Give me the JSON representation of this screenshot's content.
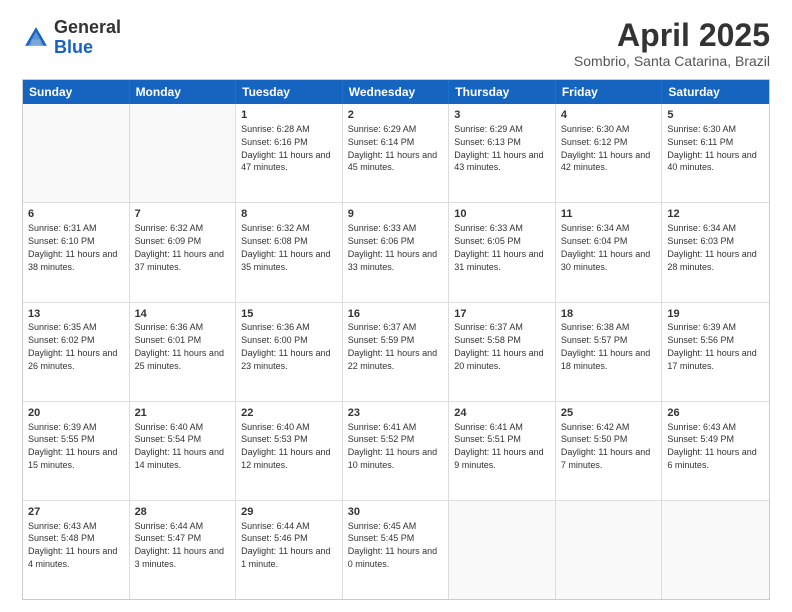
{
  "header": {
    "logo_general": "General",
    "logo_blue": "Blue",
    "month_title": "April 2025",
    "subtitle": "Sombrio, Santa Catarina, Brazil"
  },
  "days_of_week": [
    "Sunday",
    "Monday",
    "Tuesday",
    "Wednesday",
    "Thursday",
    "Friday",
    "Saturday"
  ],
  "weeks": [
    [
      {
        "day": "",
        "empty": true
      },
      {
        "day": "",
        "empty": true
      },
      {
        "day": "1",
        "sunrise": "Sunrise: 6:28 AM",
        "sunset": "Sunset: 6:16 PM",
        "daylight": "Daylight: 11 hours and 47 minutes."
      },
      {
        "day": "2",
        "sunrise": "Sunrise: 6:29 AM",
        "sunset": "Sunset: 6:14 PM",
        "daylight": "Daylight: 11 hours and 45 minutes."
      },
      {
        "day": "3",
        "sunrise": "Sunrise: 6:29 AM",
        "sunset": "Sunset: 6:13 PM",
        "daylight": "Daylight: 11 hours and 43 minutes."
      },
      {
        "day": "4",
        "sunrise": "Sunrise: 6:30 AM",
        "sunset": "Sunset: 6:12 PM",
        "daylight": "Daylight: 11 hours and 42 minutes."
      },
      {
        "day": "5",
        "sunrise": "Sunrise: 6:30 AM",
        "sunset": "Sunset: 6:11 PM",
        "daylight": "Daylight: 11 hours and 40 minutes."
      }
    ],
    [
      {
        "day": "6",
        "sunrise": "Sunrise: 6:31 AM",
        "sunset": "Sunset: 6:10 PM",
        "daylight": "Daylight: 11 hours and 38 minutes."
      },
      {
        "day": "7",
        "sunrise": "Sunrise: 6:32 AM",
        "sunset": "Sunset: 6:09 PM",
        "daylight": "Daylight: 11 hours and 37 minutes."
      },
      {
        "day": "8",
        "sunrise": "Sunrise: 6:32 AM",
        "sunset": "Sunset: 6:08 PM",
        "daylight": "Daylight: 11 hours and 35 minutes."
      },
      {
        "day": "9",
        "sunrise": "Sunrise: 6:33 AM",
        "sunset": "Sunset: 6:06 PM",
        "daylight": "Daylight: 11 hours and 33 minutes."
      },
      {
        "day": "10",
        "sunrise": "Sunrise: 6:33 AM",
        "sunset": "Sunset: 6:05 PM",
        "daylight": "Daylight: 11 hours and 31 minutes."
      },
      {
        "day": "11",
        "sunrise": "Sunrise: 6:34 AM",
        "sunset": "Sunset: 6:04 PM",
        "daylight": "Daylight: 11 hours and 30 minutes."
      },
      {
        "day": "12",
        "sunrise": "Sunrise: 6:34 AM",
        "sunset": "Sunset: 6:03 PM",
        "daylight": "Daylight: 11 hours and 28 minutes."
      }
    ],
    [
      {
        "day": "13",
        "sunrise": "Sunrise: 6:35 AM",
        "sunset": "Sunset: 6:02 PM",
        "daylight": "Daylight: 11 hours and 26 minutes."
      },
      {
        "day": "14",
        "sunrise": "Sunrise: 6:36 AM",
        "sunset": "Sunset: 6:01 PM",
        "daylight": "Daylight: 11 hours and 25 minutes."
      },
      {
        "day": "15",
        "sunrise": "Sunrise: 6:36 AM",
        "sunset": "Sunset: 6:00 PM",
        "daylight": "Daylight: 11 hours and 23 minutes."
      },
      {
        "day": "16",
        "sunrise": "Sunrise: 6:37 AM",
        "sunset": "Sunset: 5:59 PM",
        "daylight": "Daylight: 11 hours and 22 minutes."
      },
      {
        "day": "17",
        "sunrise": "Sunrise: 6:37 AM",
        "sunset": "Sunset: 5:58 PM",
        "daylight": "Daylight: 11 hours and 20 minutes."
      },
      {
        "day": "18",
        "sunrise": "Sunrise: 6:38 AM",
        "sunset": "Sunset: 5:57 PM",
        "daylight": "Daylight: 11 hours and 18 minutes."
      },
      {
        "day": "19",
        "sunrise": "Sunrise: 6:39 AM",
        "sunset": "Sunset: 5:56 PM",
        "daylight": "Daylight: 11 hours and 17 minutes."
      }
    ],
    [
      {
        "day": "20",
        "sunrise": "Sunrise: 6:39 AM",
        "sunset": "Sunset: 5:55 PM",
        "daylight": "Daylight: 11 hours and 15 minutes."
      },
      {
        "day": "21",
        "sunrise": "Sunrise: 6:40 AM",
        "sunset": "Sunset: 5:54 PM",
        "daylight": "Daylight: 11 hours and 14 minutes."
      },
      {
        "day": "22",
        "sunrise": "Sunrise: 6:40 AM",
        "sunset": "Sunset: 5:53 PM",
        "daylight": "Daylight: 11 hours and 12 minutes."
      },
      {
        "day": "23",
        "sunrise": "Sunrise: 6:41 AM",
        "sunset": "Sunset: 5:52 PM",
        "daylight": "Daylight: 11 hours and 10 minutes."
      },
      {
        "day": "24",
        "sunrise": "Sunrise: 6:41 AM",
        "sunset": "Sunset: 5:51 PM",
        "daylight": "Daylight: 11 hours and 9 minutes."
      },
      {
        "day": "25",
        "sunrise": "Sunrise: 6:42 AM",
        "sunset": "Sunset: 5:50 PM",
        "daylight": "Daylight: 11 hours and 7 minutes."
      },
      {
        "day": "26",
        "sunrise": "Sunrise: 6:43 AM",
        "sunset": "Sunset: 5:49 PM",
        "daylight": "Daylight: 11 hours and 6 minutes."
      }
    ],
    [
      {
        "day": "27",
        "sunrise": "Sunrise: 6:43 AM",
        "sunset": "Sunset: 5:48 PM",
        "daylight": "Daylight: 11 hours and 4 minutes."
      },
      {
        "day": "28",
        "sunrise": "Sunrise: 6:44 AM",
        "sunset": "Sunset: 5:47 PM",
        "daylight": "Daylight: 11 hours and 3 minutes."
      },
      {
        "day": "29",
        "sunrise": "Sunrise: 6:44 AM",
        "sunset": "Sunset: 5:46 PM",
        "daylight": "Daylight: 11 hours and 1 minute."
      },
      {
        "day": "30",
        "sunrise": "Sunrise: 6:45 AM",
        "sunset": "Sunset: 5:45 PM",
        "daylight": "Daylight: 11 hours and 0 minutes."
      },
      {
        "day": "",
        "empty": true
      },
      {
        "day": "",
        "empty": true
      },
      {
        "day": "",
        "empty": true
      }
    ]
  ]
}
